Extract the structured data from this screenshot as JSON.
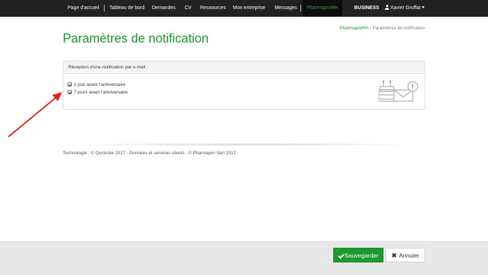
{
  "navbar": {
    "items": [
      {
        "label": "Page d'accueil"
      },
      {
        "label": "Tableau de bord"
      },
      {
        "label": "Demandes"
      },
      {
        "label": "CV"
      },
      {
        "label": "Ressources"
      },
      {
        "label": "Mon entreprise"
      },
      {
        "label": "Messages"
      }
    ],
    "active_label": "PharmaproRH",
    "business_label": "BUSINESS",
    "user_label": "Xavier Gruffat",
    "active_color": "#25a93a"
  },
  "page": {
    "title": "Paramètres de notification",
    "breadcrumb": [
      {
        "label": "PharmaproRH"
      },
      {
        "label": "Paramètres de notification"
      }
    ],
    "breadcrumb_separator": "/"
  },
  "panel": {
    "heading": "Réception d'une notification par e-mail",
    "options": [
      {
        "label": "1 jour avant l'anniversaire",
        "checked": true
      },
      {
        "label": "7 jours avant l'anniversaire",
        "checked": true
      }
    ],
    "illustration_icons": [
      "birthday-cake-icon",
      "envelope-notification-icon"
    ]
  },
  "footer": {
    "text": "Technologie : © Quicksite 2017 - Données et services clients : © Pharmapro Sàrl 2017"
  },
  "actions": {
    "save_label": "Sauvegarder",
    "cancel_label": "Annuler",
    "save_icon": "check-icon",
    "cancel_icon": "times-icon",
    "save_color": "#1c9a2f"
  },
  "colors": {
    "brand": "#1a9a2c",
    "navbar": "#222222",
    "annotation_arrow": "#e8201a"
  }
}
